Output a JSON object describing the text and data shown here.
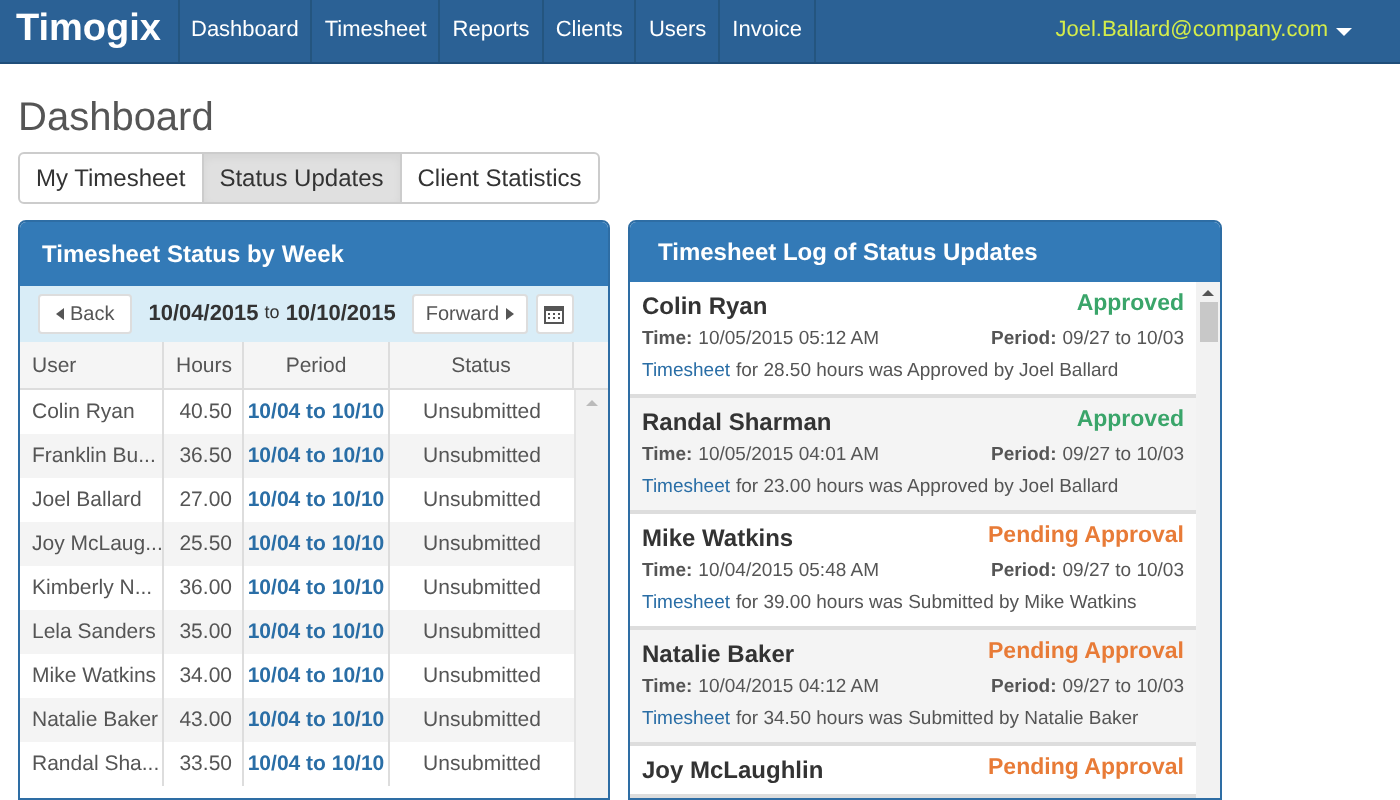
{
  "navbar": {
    "brand": "Timogix",
    "items": [
      {
        "label": "Dashboard"
      },
      {
        "label": "Timesheet"
      },
      {
        "label": "Reports"
      },
      {
        "label": "Clients"
      },
      {
        "label": "Users"
      },
      {
        "label": "Invoice"
      }
    ],
    "user": "Joel.Ballard@company.com"
  },
  "page_title": "Dashboard",
  "tabs": [
    {
      "label": "My Timesheet",
      "selected": false
    },
    {
      "label": "Status Updates",
      "selected": true
    },
    {
      "label": "Client Statistics",
      "selected": false
    }
  ],
  "status_panel": {
    "title": "Timesheet Status by Week",
    "back": "Back",
    "forward": "Forward",
    "range_start": "10/04/2015",
    "range_sep": "to",
    "range_end": "10/10/2015",
    "columns": [
      "User",
      "Hours",
      "Period",
      "Status"
    ],
    "rows": [
      {
        "user": "Colin Ryan",
        "hours": "40.50",
        "period": "10/04 to 10/10",
        "status": "Unsubmitted"
      },
      {
        "user": "Franklin Bu...",
        "hours": "36.50",
        "period": "10/04 to 10/10",
        "status": "Unsubmitted"
      },
      {
        "user": "Joel Ballard",
        "hours": "27.00",
        "period": "10/04 to 10/10",
        "status": "Unsubmitted"
      },
      {
        "user": "Joy McLaug...",
        "hours": "25.50",
        "period": "10/04 to 10/10",
        "status": "Unsubmitted"
      },
      {
        "user": "Kimberly N...",
        "hours": "36.00",
        "period": "10/04 to 10/10",
        "status": "Unsubmitted"
      },
      {
        "user": "Lela Sanders",
        "hours": "35.00",
        "period": "10/04 to 10/10",
        "status": "Unsubmitted"
      },
      {
        "user": "Mike Watkins",
        "hours": "34.00",
        "period": "10/04 to 10/10",
        "status": "Unsubmitted"
      },
      {
        "user": "Natalie Baker",
        "hours": "43.00",
        "period": "10/04 to 10/10",
        "status": "Unsubmitted"
      },
      {
        "user": "Randal Sha...",
        "hours": "33.50",
        "period": "10/04 to 10/10",
        "status": "Unsubmitted"
      }
    ]
  },
  "log_panel": {
    "title": "Timesheet Log of Status Updates",
    "entries": [
      {
        "name": "Colin Ryan",
        "status": "Approved",
        "kind": "approved",
        "time_label": "Time:",
        "time": "10/05/2015 05:12 AM",
        "period_label": "Period:",
        "period": "09/27 to 10/03",
        "link": "Timesheet",
        "message": "for 28.50 hours was Approved by Joel Ballard"
      },
      {
        "name": "Randal Sharman",
        "status": "Approved",
        "kind": "approved",
        "time_label": "Time:",
        "time": "10/05/2015 04:01 AM",
        "period_label": "Period:",
        "period": "09/27 to 10/03",
        "link": "Timesheet",
        "message": "for 23.00 hours was Approved by Joel Ballard"
      },
      {
        "name": "Mike Watkins",
        "status": "Pending Approval",
        "kind": "pending",
        "time_label": "Time:",
        "time": "10/04/2015 05:48 AM",
        "period_label": "Period:",
        "period": "09/27 to 10/03",
        "link": "Timesheet",
        "message": "for 39.00 hours was Submitted by Mike Watkins"
      },
      {
        "name": "Natalie Baker",
        "status": "Pending Approval",
        "kind": "pending",
        "time_label": "Time:",
        "time": "10/04/2015 04:12 AM",
        "period_label": "Period:",
        "period": "09/27 to 10/03",
        "link": "Timesheet",
        "message": "for 34.50 hours was Submitted by Natalie Baker"
      },
      {
        "name": "Joy McLaughlin",
        "status": "Pending Approval",
        "kind": "pending"
      }
    ]
  }
}
